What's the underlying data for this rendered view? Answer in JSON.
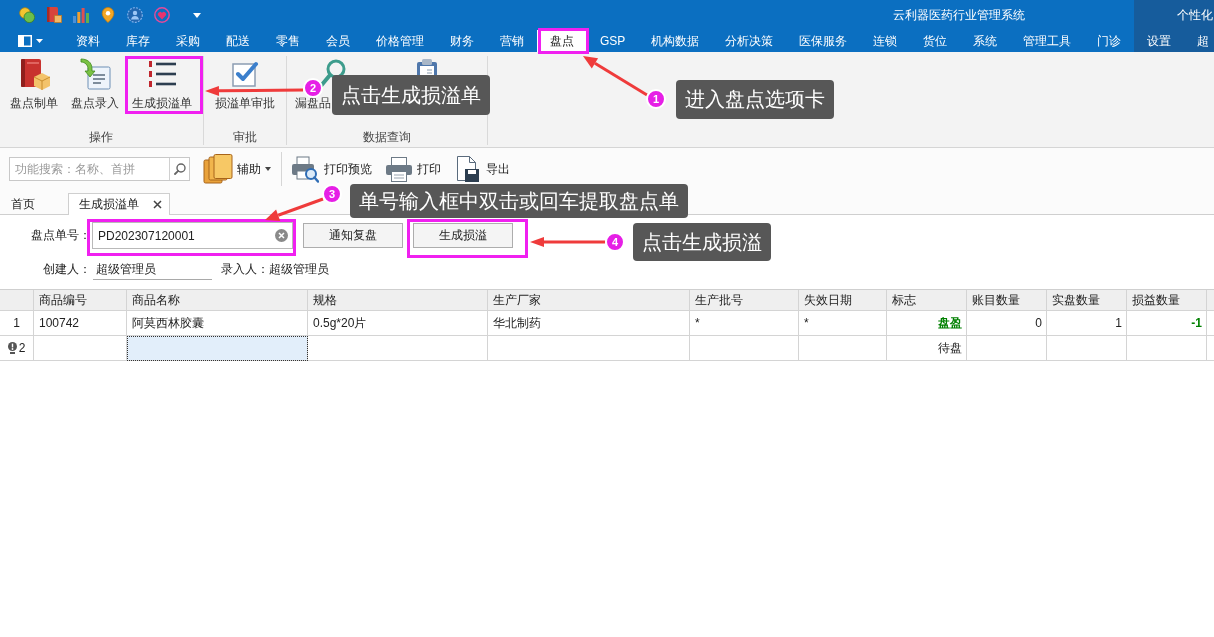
{
  "title_bar": {
    "title": "云利器医药行业管理系统",
    "personalize": "个性化"
  },
  "menu_tabs": [
    {
      "label": "资料",
      "selected": false
    },
    {
      "label": "库存",
      "selected": false
    },
    {
      "label": "采购",
      "selected": false
    },
    {
      "label": "配送",
      "selected": false
    },
    {
      "label": "零售",
      "selected": false
    },
    {
      "label": "会员",
      "selected": false
    },
    {
      "label": "价格管理",
      "selected": false
    },
    {
      "label": "财务",
      "selected": false
    },
    {
      "label": "营销",
      "selected": false
    },
    {
      "label": "盘点",
      "selected": true
    },
    {
      "label": "GSP",
      "selected": false
    },
    {
      "label": "机构数据",
      "selected": false
    },
    {
      "label": "分析决策",
      "selected": false
    },
    {
      "label": "医保服务",
      "selected": false
    },
    {
      "label": "连锁",
      "selected": false
    },
    {
      "label": "货位",
      "selected": false
    },
    {
      "label": "系统",
      "selected": false
    },
    {
      "label": "管理工具",
      "selected": false
    },
    {
      "label": "门诊",
      "selected": false
    }
  ],
  "right_tabs": [
    {
      "label": "设置",
      "selected": false
    },
    {
      "label": "超",
      "selected": false
    }
  ],
  "ribbon": {
    "groups": [
      {
        "label": "操作",
        "buttons": [
          {
            "label": "盘点制单"
          },
          {
            "label": "盘点录入"
          },
          {
            "label": "生成损溢单"
          }
        ]
      },
      {
        "label": "审批",
        "buttons": [
          {
            "label": "损溢单审批"
          }
        ]
      },
      {
        "label": "数据查询",
        "buttons": [
          {
            "label": "漏盘品"
          }
        ]
      }
    ]
  },
  "toolbar": {
    "search": {
      "placeholder": "功能搜索：名称、首拼"
    },
    "buttons": [
      {
        "label": "辅助",
        "dropdown": true
      },
      {
        "label": "打印预览",
        "dropdown": false
      },
      {
        "label": "打印",
        "dropdown": false
      },
      {
        "label": "导出",
        "dropdown": false
      }
    ]
  },
  "doc_tabs": [
    {
      "label": "首页",
      "selected": false,
      "closable": false
    },
    {
      "label": "生成损溢单",
      "selected": true,
      "closable": true
    }
  ],
  "form": {
    "order_no": {
      "label": "盘点单号：",
      "value": "PD202307120001"
    },
    "buttons": [
      "通知复盘",
      "生成损溢"
    ],
    "creator": {
      "label": "创建人：",
      "value": "超级管理员"
    },
    "recorder": {
      "label": "录入人：",
      "value": "超级管理员"
    }
  },
  "table": {
    "columns": [
      {
        "label": "商品编号",
        "kind": "text"
      },
      {
        "label": "商品名称",
        "kind": "text"
      },
      {
        "label": "规格",
        "kind": "text"
      },
      {
        "label": "生产厂家",
        "kind": "text"
      },
      {
        "label": "生产批号",
        "kind": "text"
      },
      {
        "label": "失效日期",
        "kind": "text"
      },
      {
        "label": "标志",
        "kind": "flag"
      },
      {
        "label": "账目数量",
        "kind": "number"
      },
      {
        "label": "实盘数量",
        "kind": "number"
      },
      {
        "label": "损益数量",
        "kind": "number"
      }
    ],
    "rows": [
      {
        "number": "1",
        "flagged": false,
        "cells": [
          {
            "text": "100742",
            "selected": false
          },
          {
            "text": "阿莫西林胶囊",
            "selected": false
          },
          {
            "text": "0.5g*20片",
            "selected": false
          },
          {
            "text": "华北制药",
            "selected": false
          },
          {
            "text": "*",
            "selected": false
          },
          {
            "text": "*",
            "selected": false
          },
          {
            "text": "盘盈",
            "selected": false,
            "color": "#008000"
          },
          {
            "text": "0",
            "selected": false
          },
          {
            "text": "1",
            "selected": false
          },
          {
            "text": "-1",
            "selected": false,
            "color": "#008000"
          }
        ]
      },
      {
        "number": "2",
        "flagged": true,
        "cells": [
          {
            "selected": false
          },
          {
            "selected": true
          },
          {
            "selected": false
          },
          {
            "selected": false
          },
          {
            "selected": false
          },
          {
            "selected": false
          },
          {
            "text": "待盘",
            "selected": false
          },
          {
            "selected": false
          },
          {
            "selected": false
          },
          {
            "selected": false
          }
        ]
      }
    ]
  },
  "annotations": [
    {
      "number": "2",
      "text": "点击生成损溢单"
    },
    {
      "number": "1",
      "text": "进入盘点选项卡"
    },
    {
      "number": "3",
      "text": "单号输入框中双击或回车提取盘点单"
    },
    {
      "number": "4",
      "text": "点击生成损溢"
    }
  ]
}
